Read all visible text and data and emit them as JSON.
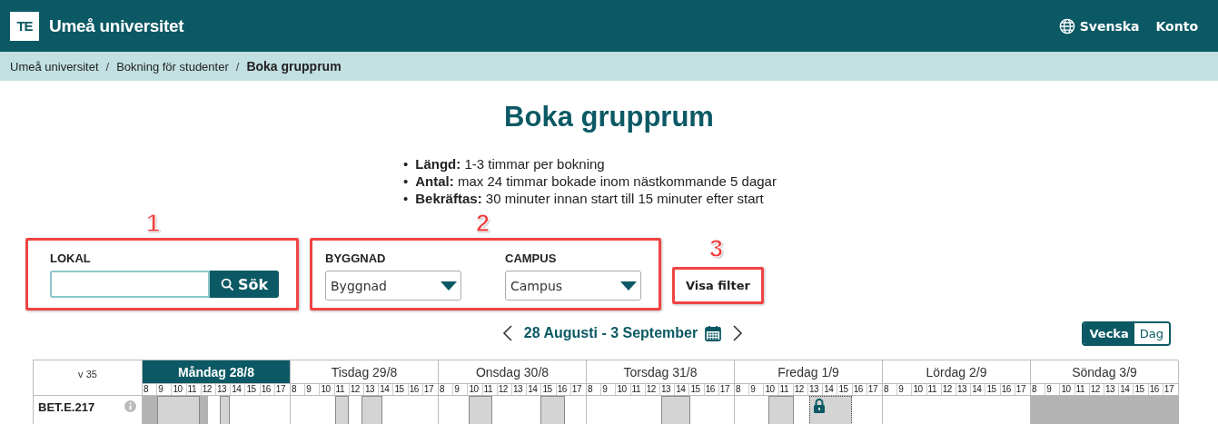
{
  "header": {
    "logo": "TE",
    "title": "Umeå universitet",
    "language": "Svenska",
    "account": "Konto"
  },
  "breadcrumbs": [
    {
      "label": "Umeå universitet",
      "current": false
    },
    {
      "separator": "/",
      "label": "Bokning för studenter",
      "current": false
    },
    {
      "separator": "/",
      "label": "Boka grupprum",
      "current": true
    }
  ],
  "page_title": "Boka grupprum",
  "rules": [
    {
      "marker": "•",
      "text": "**Längd:** 1-3 timmar per bokning"
    },
    {
      "marker": "•",
      "text": "**Antal:** max 24 timmar bokade inom nästkommande 5 dagar"
    },
    {
      "marker": "•",
      "text": "**Bekräftas:** 30 minuter innan start till 15 minuter efter start"
    }
  ],
  "search": {
    "callout": "1",
    "label": "LOKAL",
    "button": "Sök"
  },
  "filters": {
    "callout": "2",
    "fields": [
      {
        "label": "BYGGNAD",
        "value": "Byggnad"
      },
      {
        "label": "CAMPUS",
        "value": "Campus"
      }
    ]
  },
  "filter_button": {
    "callout": "3",
    "label": "Visa filter"
  },
  "week_nav": {
    "range": "28 Augusti - 3 September"
  },
  "view_toggle": [
    {
      "label": "Vecka",
      "selected": true
    },
    {
      "label": "Dag",
      "selected": false
    }
  ],
  "schedule": {
    "week": "v 35",
    "days": [
      {
        "label": "Måndag 28/8",
        "selected": true,
        "hours": [
          "8",
          "9",
          "10",
          "11",
          "12",
          "13",
          "14",
          "15",
          "16",
          "17"
        ]
      },
      {
        "label": "Tisdag 29/8",
        "selected": false,
        "hours": [
          "8",
          "9",
          "10",
          "11",
          "12",
          "13",
          "14",
          "15",
          "16",
          "17"
        ]
      },
      {
        "label": "Onsdag 30/8",
        "selected": false,
        "hours": [
          "8",
          "9",
          "10",
          "11",
          "12",
          "13",
          "14",
          "15",
          "16",
          "17"
        ]
      },
      {
        "label": "Torsdag 31/8",
        "selected": false,
        "hours": [
          "8",
          "9",
          "10",
          "11",
          "12",
          "13",
          "14",
          "15",
          "16",
          "17"
        ]
      },
      {
        "label": "Fredag 1/9",
        "selected": false,
        "hours": [
          "8",
          "9",
          "10",
          "11",
          "12",
          "13",
          "14",
          "15",
          "16",
          "17"
        ]
      },
      {
        "label": "Lördag 2/9",
        "selected": false,
        "hours": [
          "8",
          "9",
          "10",
          "11",
          "12",
          "13",
          "14",
          "15",
          "16",
          "17"
        ]
      },
      {
        "label": "Söndag 3/9",
        "selected": false,
        "hours": [
          "8",
          "9",
          "10",
          "11",
          "12",
          "13",
          "14",
          "15",
          "16",
          "17"
        ]
      }
    ],
    "rooms": [
      {
        "name": "BET.E.217",
        "blocks": [
          {
            "kind": "unavailable"
          },
          {
            "kind": "booked"
          },
          {
            "kind": "unavailable"
          },
          {
            "kind": "booked"
          },
          {
            "kind": "booked"
          },
          {
            "kind": "booked"
          },
          {
            "kind": "booked"
          },
          {
            "kind": "booked"
          },
          {
            "kind": "booked"
          },
          {
            "kind": "booked"
          },
          {
            "kind": "locked"
          },
          {
            "kind": "unavailable"
          }
        ]
      }
    ]
  }
}
